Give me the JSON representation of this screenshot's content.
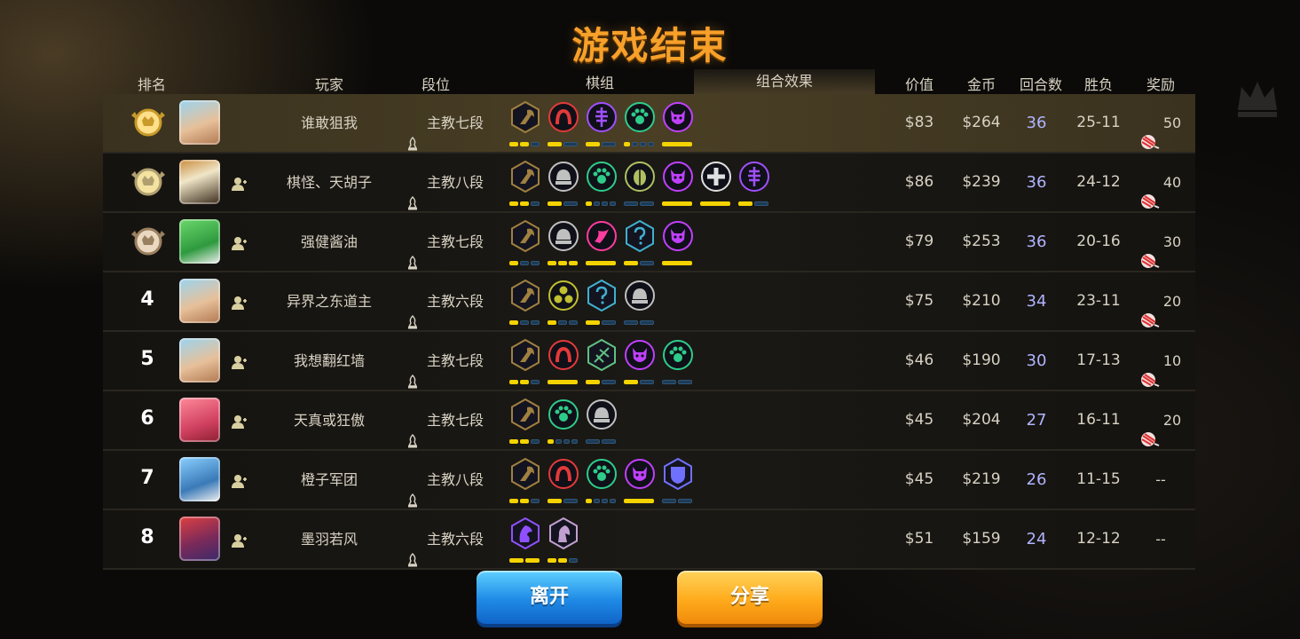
{
  "title": "游戏结束",
  "headers": {
    "rank": "排名",
    "player": "玩家",
    "tier": "段位",
    "team": "棋组",
    "synergy": "组合效果",
    "value": "价值",
    "gold": "金币",
    "rounds": "回合数",
    "record": "胜负",
    "reward": "奖励"
  },
  "colors": {
    "accent_title": "#f7a02a",
    "rounds_text": "#b0b4ff",
    "bar_on": "#f5d300",
    "bar_off": "#1d3a55",
    "leave_button": "#1f8ae6",
    "share_button": "#ffab1c"
  },
  "rows": [
    {
      "rank": "1",
      "rank_icon": "gold-crown-medal-icon",
      "avatar": "hero-avatar-white-hair",
      "player": "谁敢狙我",
      "tier": "主教七段",
      "value": "$83",
      "gold": "$264",
      "rounds": "36",
      "record": "25-11",
      "reward": "50",
      "traits": [
        {
          "icon": "axe-icon",
          "color": "#a08040"
        },
        {
          "icon": "arch-icon",
          "color": "#e33a3a"
        },
        {
          "icon": "fishbone-icon",
          "color": "#a050ff"
        },
        {
          "icon": "paw-icon",
          "color": "#2ecc8a"
        },
        {
          "icon": "demon-icon",
          "color": "#c040ff"
        }
      ],
      "bars": [
        [
          1,
          1,
          0
        ],
        [
          1,
          0
        ],
        [
          1,
          0
        ],
        [
          1,
          0,
          0,
          0
        ],
        [
          1
        ]
      ]
    },
    {
      "rank": "2",
      "rank_icon": "silver-medal-icon",
      "avatar": "hero-avatar-framed-owl",
      "player": "棋怪、天胡子",
      "tier": "主教八段",
      "value": "$86",
      "gold": "$239",
      "rounds": "36",
      "record": "24-12",
      "reward": "40",
      "traits": [
        {
          "icon": "axe-icon",
          "color": "#a08040"
        },
        {
          "icon": "helmet-icon",
          "color": "#c0c0c0"
        },
        {
          "icon": "paw-icon",
          "color": "#2ecc8a"
        },
        {
          "icon": "beetle-icon",
          "color": "#b0c060"
        },
        {
          "icon": "demon-icon",
          "color": "#c040ff"
        },
        {
          "icon": "cross-icon",
          "color": "#e0e0e0"
        },
        {
          "icon": "fishbone-icon",
          "color": "#a050ff"
        }
      ],
      "bars": [
        [
          1,
          1,
          0
        ],
        [
          1,
          0
        ],
        [
          1,
          0,
          0,
          0
        ],
        [
          0,
          0
        ],
        [
          1
        ],
        [
          1
        ],
        [
          1,
          0
        ]
      ]
    },
    {
      "rank": "3",
      "rank_icon": "bronze-medal-icon",
      "avatar": "hero-avatar-green-frog",
      "player": "强健酱油",
      "tier": "主教七段",
      "value": "$79",
      "gold": "$253",
      "rounds": "36",
      "record": "20-16",
      "reward": "30",
      "traits": [
        {
          "icon": "axe-icon",
          "color": "#a08040"
        },
        {
          "icon": "helmet-icon",
          "color": "#c0c0c0"
        },
        {
          "icon": "wave-icon",
          "color": "#ff3ca0"
        },
        {
          "icon": "question-icon",
          "color": "#40b0d0"
        },
        {
          "icon": "demon-icon",
          "color": "#c040ff"
        }
      ],
      "bars": [
        [
          1,
          0,
          0
        ],
        [
          1,
          1,
          1
        ],
        [
          1
        ],
        [
          1,
          0
        ],
        [
          1
        ]
      ]
    },
    {
      "rank": "4",
      "rank_icon": "",
      "avatar": "hero-avatar-white-hair",
      "player": "异界之东道主",
      "tier": "主教六段",
      "value": "$75",
      "gold": "$210",
      "rounds": "34",
      "record": "23-11",
      "reward": "20",
      "traits": [
        {
          "icon": "axe-icon",
          "color": "#a08040"
        },
        {
          "icon": "triad-icon",
          "color": "#c0c030"
        },
        {
          "icon": "question-icon",
          "color": "#40b0d0"
        },
        {
          "icon": "helmet-icon",
          "color": "#c0c0c0"
        }
      ],
      "bars": [
        [
          1,
          0,
          0
        ],
        [
          1,
          0,
          0
        ],
        [
          1,
          0
        ],
        [
          0,
          0
        ]
      ]
    },
    {
      "rank": "5",
      "rank_icon": "",
      "avatar": "hero-avatar-white-hair",
      "player": "我想翻红墙",
      "tier": "主教七段",
      "value": "$46",
      "gold": "$190",
      "rounds": "30",
      "record": "17-13",
      "reward": "10",
      "traits": [
        {
          "icon": "axe-icon",
          "color": "#a08040"
        },
        {
          "icon": "arch-icon",
          "color": "#e33a3a"
        },
        {
          "icon": "claw-icon",
          "color": "#60c080"
        },
        {
          "icon": "demon-icon",
          "color": "#c040ff"
        },
        {
          "icon": "paw-icon",
          "color": "#2ecc8a"
        }
      ],
      "bars": [
        [
          1,
          1,
          0
        ],
        [
          1
        ],
        [
          1,
          0
        ],
        [
          1,
          0
        ],
        [
          0,
          0
        ]
      ]
    },
    {
      "rank": "6",
      "rank_icon": "",
      "avatar": "hero-avatar-red-beast",
      "player": "天真或狂傲",
      "tier": "主教七段",
      "value": "$45",
      "gold": "$204",
      "rounds": "27",
      "record": "16-11",
      "reward": "20",
      "traits": [
        {
          "icon": "axe-icon",
          "color": "#a08040"
        },
        {
          "icon": "paw-icon",
          "color": "#2ecc8a"
        },
        {
          "icon": "helmet-icon",
          "color": "#c0c0c0"
        }
      ],
      "bars": [
        [
          1,
          1,
          0
        ],
        [
          1,
          0,
          0,
          0
        ],
        [
          0,
          0
        ]
      ]
    },
    {
      "rank": "7",
      "rank_icon": "",
      "avatar": "hero-avatar-shark",
      "player": "橙子军团",
      "tier": "主教八段",
      "value": "$45",
      "gold": "$219",
      "rounds": "26",
      "record": "11-15",
      "reward": "--",
      "traits": [
        {
          "icon": "axe-icon",
          "color": "#a08040"
        },
        {
          "icon": "arch-icon",
          "color": "#e33a3a"
        },
        {
          "icon": "paw-icon",
          "color": "#2ecc8a"
        },
        {
          "icon": "demon-icon",
          "color": "#c040ff"
        },
        {
          "icon": "shield-icon",
          "color": "#7070ff"
        }
      ],
      "bars": [
        [
          1,
          1,
          0
        ],
        [
          1,
          0
        ],
        [
          1,
          0,
          0,
          0
        ],
        [
          1
        ],
        [
          0,
          0
        ]
      ]
    },
    {
      "rank": "8",
      "rank_icon": "",
      "avatar": "hero-avatar-monkey-king",
      "player": "墨羽若风",
      "tier": "主教六段",
      "value": "$51",
      "gold": "$159",
      "rounds": "24",
      "record": "12-12",
      "reward": "--",
      "traits": [
        {
          "icon": "dragon-head-icon",
          "color": "#9050ff"
        },
        {
          "icon": "knight-icon",
          "color": "#c0a0d0"
        }
      ],
      "bars": [
        [
          1,
          1
        ],
        [
          1,
          1,
          0
        ]
      ]
    }
  ],
  "buttons": {
    "leave": "离开",
    "share": "分享"
  }
}
